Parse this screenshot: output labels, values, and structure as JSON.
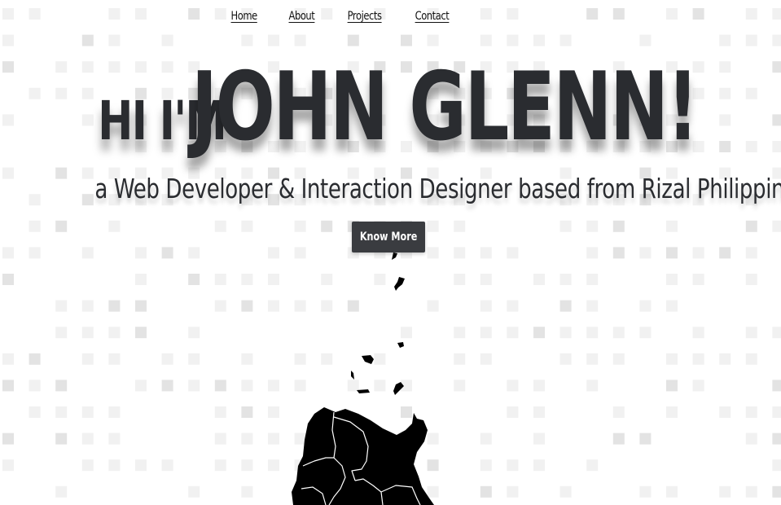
{
  "nav": {
    "items": [
      {
        "label": "Home"
      },
      {
        "label": "About"
      },
      {
        "label": "Projects"
      },
      {
        "label": "Contact"
      }
    ]
  },
  "hero": {
    "greeting": "HI I'M",
    "name": "JOHN GLENN!",
    "tagline": "a Web Developer & Interaction Designer based from Rizal Philippines",
    "cta_label": "Know More"
  },
  "colors": {
    "text": "#2a2c30",
    "button_bg": "#3a3c40",
    "map_fill": "#000000",
    "tile_light": "#f1f1f1",
    "tile_dark": "#e3e3e3"
  },
  "decoration": {
    "map_icon": "philippines-map-silhouette",
    "background_pattern": "square-tile-grid"
  }
}
